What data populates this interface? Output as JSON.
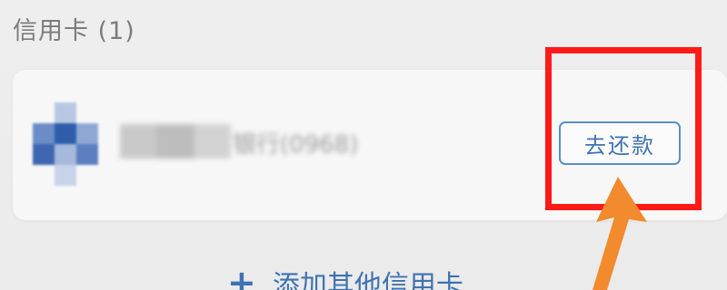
{
  "header": {
    "section_title": "信用卡 (1)"
  },
  "card": {
    "bank_name": "银行(0968)",
    "repay_button_label": "去还款"
  },
  "actions": {
    "add_card_label": "添加其他信用卡",
    "add_card_icon": "+"
  },
  "icons": {
    "bank_logo": "bank-logo-icon",
    "add": "plus-icon",
    "annotation_arrow": "arrow-icon"
  },
  "colors": {
    "accent": "#3f73b0",
    "highlight": "#ff1a1a",
    "arrow": "#f28a2e"
  }
}
